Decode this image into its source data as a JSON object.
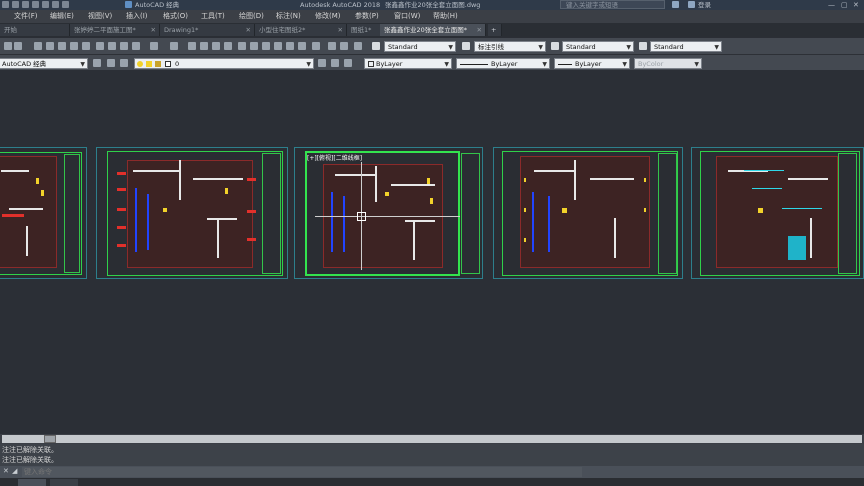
{
  "titlebar": {
    "workspace": "AutoCAD 经典",
    "app_title": "Autodesk AutoCAD 2018",
    "filename": "张鑫鑫作业20张全套立面图.dwg",
    "search_placeholder": "键入关键字或短语",
    "user": "登录"
  },
  "menu": [
    "文件(F)",
    "编辑(E)",
    "视图(V)",
    "插入(I)",
    "格式(O)",
    "工具(T)",
    "绘图(D)",
    "标注(N)",
    "修改(M)",
    "参数(P)",
    "窗口(W)",
    "帮助(H)"
  ],
  "tabs": [
    {
      "label": "开始"
    },
    {
      "label": "张婷婷二平面施工图*"
    },
    {
      "label": "Drawing1*"
    },
    {
      "label": "小型住宅图纸2*"
    },
    {
      "label": "图纸1*"
    },
    {
      "label": "张鑫鑫作业20张全套立面图*"
    }
  ],
  "toolbar1": {
    "text_style": "Standard",
    "dim_style": "标注引线",
    "table_style": "Standard",
    "multileader_style": "Standard"
  },
  "toolbar2": {
    "workspace": "AutoCAD 经典",
    "layer": "0",
    "color": "ByLayer",
    "linetype": "ByLayer",
    "lineweight": "ByLayer",
    "plotstyle": "ByColor"
  },
  "drawing": {
    "sheet3_label": "[+][俯视][二维线框]"
  },
  "command": {
    "history": [
      "注注已解除关联。",
      "注注已解除关联。"
    ],
    "input_placeholder": "键入命令"
  }
}
